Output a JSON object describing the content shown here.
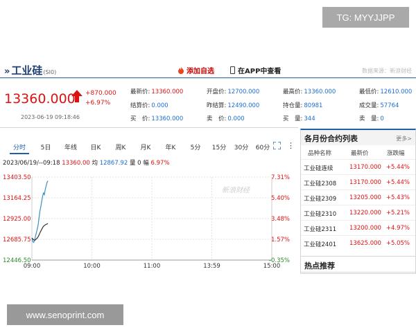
{
  "overlay": {
    "tg": "TG: MYYJJPP",
    "website": "www.senoprint.com"
  },
  "header": {
    "title": "工业硅",
    "code": "(SI0)",
    "add_favorite": "添加自选",
    "app_view": "在APP中查看",
    "source": "数据来源：新浪财经"
  },
  "quote": {
    "price": "13360.000",
    "change": "+870.000",
    "change_pct": "+6.97%",
    "timestamp": "2023-06-19 09:18:46",
    "fields": {
      "latest_label": "最新价:",
      "latest": "13360.000",
      "open_label": "开盘价:",
      "open": "12700.000",
      "high_label": "最高价:",
      "high": "13360.000",
      "low_label": "最低价:",
      "low": "12610.000",
      "settle_label": "结算价:",
      "settle": "0.000",
      "prev_settle_label": "昨结算:",
      "prev_settle": "12490.000",
      "oi_label": "持仓量:",
      "oi": "80981",
      "vol_label": "成交量:",
      "vol": "57764",
      "buy_price_label": "买　价:",
      "buy_price": "13360.000",
      "sell_price_label": "卖　价:",
      "sell_price": "0.000",
      "buy_vol_label": "买　量:",
      "buy_vol": "344",
      "sell_vol_label": "卖　量:",
      "sell_vol": "0"
    }
  },
  "chart_tabs": [
    "分时",
    "5日",
    "年线",
    "日K",
    "周K",
    "月K",
    "年K",
    "5分",
    "15分",
    "30分",
    "60分"
  ],
  "chart_info": {
    "datetime": "2023/06/19/--09:18",
    "price": "13360.00",
    "avg_label": "均",
    "avg": "12867.92",
    "vol_label": "量",
    "vol": "0",
    "amp_label": "幅",
    "amp": "6.97%"
  },
  "chart_data": {
    "type": "line",
    "x_tick_labels": [
      "09:00",
      "10:00",
      "11:00",
      "13:59",
      "15:00"
    ],
    "y_left_ticks": [
      "13403.50",
      "13164.25",
      "12925.00",
      "12685.75",
      "12446.50"
    ],
    "y_right_ticks": [
      "7.31%",
      "5.40%",
      "3.48%",
      "1.57%",
      "-0.35%"
    ],
    "ylim": [
      12446.5,
      13403.5
    ],
    "watermark": "新浪财经",
    "series": [
      {
        "role": "price",
        "color": "#3a8fc5",
        "x": [
          0,
          1,
          2,
          3,
          4,
          5,
          6,
          7,
          8,
          9,
          10,
          11,
          12,
          13,
          14,
          15,
          16,
          17,
          18
        ],
        "values": [
          12700,
          12660,
          12650,
          12670,
          12720,
          12760,
          12800,
          12850,
          12930,
          13010,
          13060,
          13120,
          13180,
          13220,
          13200,
          13260,
          13300,
          13340,
          13360
        ]
      },
      {
        "role": "average",
        "color": "#333333",
        "x": [
          0,
          1,
          2,
          3,
          4,
          5,
          6,
          7,
          8,
          9,
          10,
          11,
          12,
          13,
          14,
          15,
          16,
          17,
          18
        ],
        "values": [
          12700,
          12690,
          12680,
          12675,
          12680,
          12690,
          12700,
          12715,
          12735,
          12760,
          12780,
          12800,
          12820,
          12835,
          12845,
          12852,
          12858,
          12863,
          12868
        ]
      }
    ]
  },
  "contracts": {
    "title": "各月份合约列表",
    "more": "更多>",
    "col_name": "品种名称",
    "col_price": "最新价",
    "col_change": "涨跌幅",
    "rows": [
      {
        "name": "工业硅连续",
        "price": "13170.000",
        "change": "+5.44%"
      },
      {
        "name": "工业硅2308",
        "price": "13170.000",
        "change": "+5.44%"
      },
      {
        "name": "工业硅2309",
        "price": "13205.000",
        "change": "+5.43%"
      },
      {
        "name": "工业硅2310",
        "price": "13220.000",
        "change": "+5.21%"
      },
      {
        "name": "工业硅2311",
        "price": "13200.000",
        "change": "+4.97%"
      },
      {
        "name": "工业硅2401",
        "price": "13625.000",
        "change": "+5.05%"
      }
    ]
  },
  "hot": "热点推荐"
}
